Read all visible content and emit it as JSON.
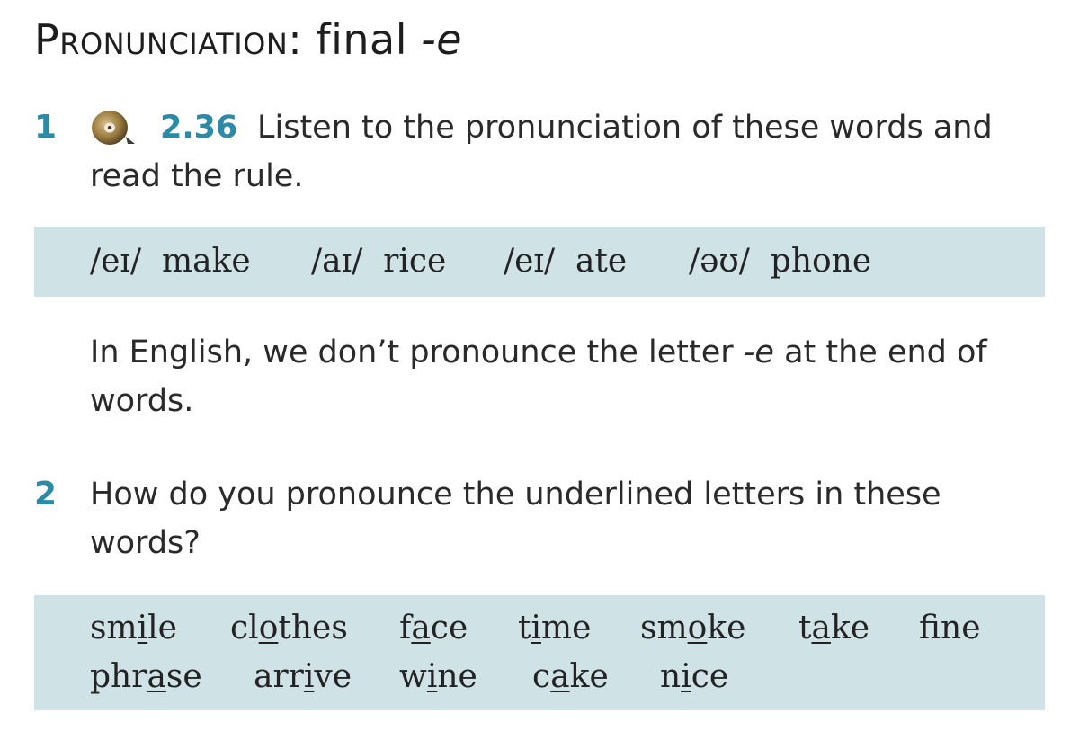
{
  "title": {
    "word": "Pronunciation",
    "colon": ":",
    "main": "final",
    "suffix": "-e"
  },
  "exercise1": {
    "number": "1",
    "audio_icon": "cd-icon",
    "track": "2.36",
    "instruction_line1": "Listen to the pronunciation of these words and",
    "instruction_line2": "read the rule.",
    "words": [
      {
        "ipa": "/eɪ/",
        "word": "make"
      },
      {
        "ipa": "/aɪ/",
        "word": "rice"
      },
      {
        "ipa": "/eɪ/",
        "word": "ate"
      },
      {
        "ipa": "/əʊ/",
        "word": "phone"
      }
    ],
    "rule_line1_a": "In English, we don’t pronounce the letter",
    "rule_line1_em": "-e",
    "rule_line1_b": "at the end of",
    "rule_line2": "words."
  },
  "exercise2": {
    "number": "2",
    "instruction_line1": "How do you pronounce the underlined letters in these",
    "instruction_line2": "words?",
    "row1": [
      {
        "pre": "sm",
        "u": "i",
        "post": "le"
      },
      {
        "pre": "cl",
        "u": "o",
        "post": "thes"
      },
      {
        "pre": "f",
        "u": "a",
        "post": "ce"
      },
      {
        "pre": "t",
        "u": "i",
        "post": "me"
      },
      {
        "pre": "sm",
        "u": "o",
        "post": "ke"
      },
      {
        "pre": "t",
        "u": "a",
        "post": "ke"
      },
      {
        "pre": "f",
        "u": "i",
        "post": "ne"
      }
    ],
    "row2": [
      {
        "pre": "phr",
        "u": "a",
        "post": "se"
      },
      {
        "pre": "arr",
        "u": "i",
        "post": "ve"
      },
      {
        "pre": "w",
        "u": "i",
        "post": "ne"
      },
      {
        "pre": "c",
        "u": "a",
        "post": "ke"
      },
      {
        "pre": "n",
        "u": "i",
        "post": "ce"
      }
    ]
  },
  "colors": {
    "accent": "#2b8ba6",
    "box_bg": "#cfe2e6",
    "text": "#2a2a2a"
  }
}
